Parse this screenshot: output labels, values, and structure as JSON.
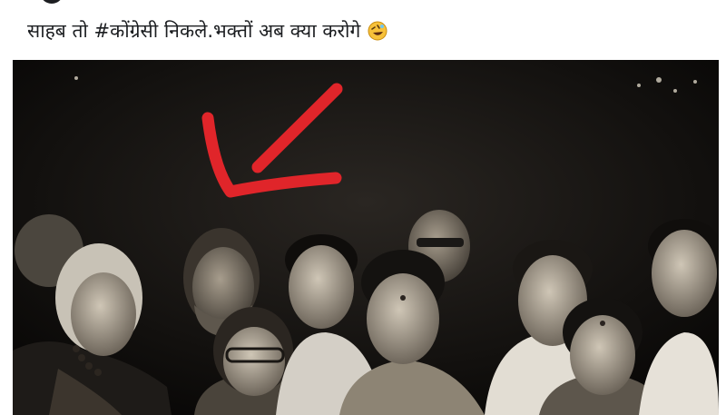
{
  "post": {
    "caption": "साहब तो #कोंग्रेसी निकले.भक्तों अब क्या करोगे",
    "emoji": "rolling-on-the-floor-laughing-icon"
  },
  "photo": {
    "description_icon": "sepia-group-photo",
    "annotation": "red-arrow-icon",
    "annotation_color": "#e0252a"
  }
}
